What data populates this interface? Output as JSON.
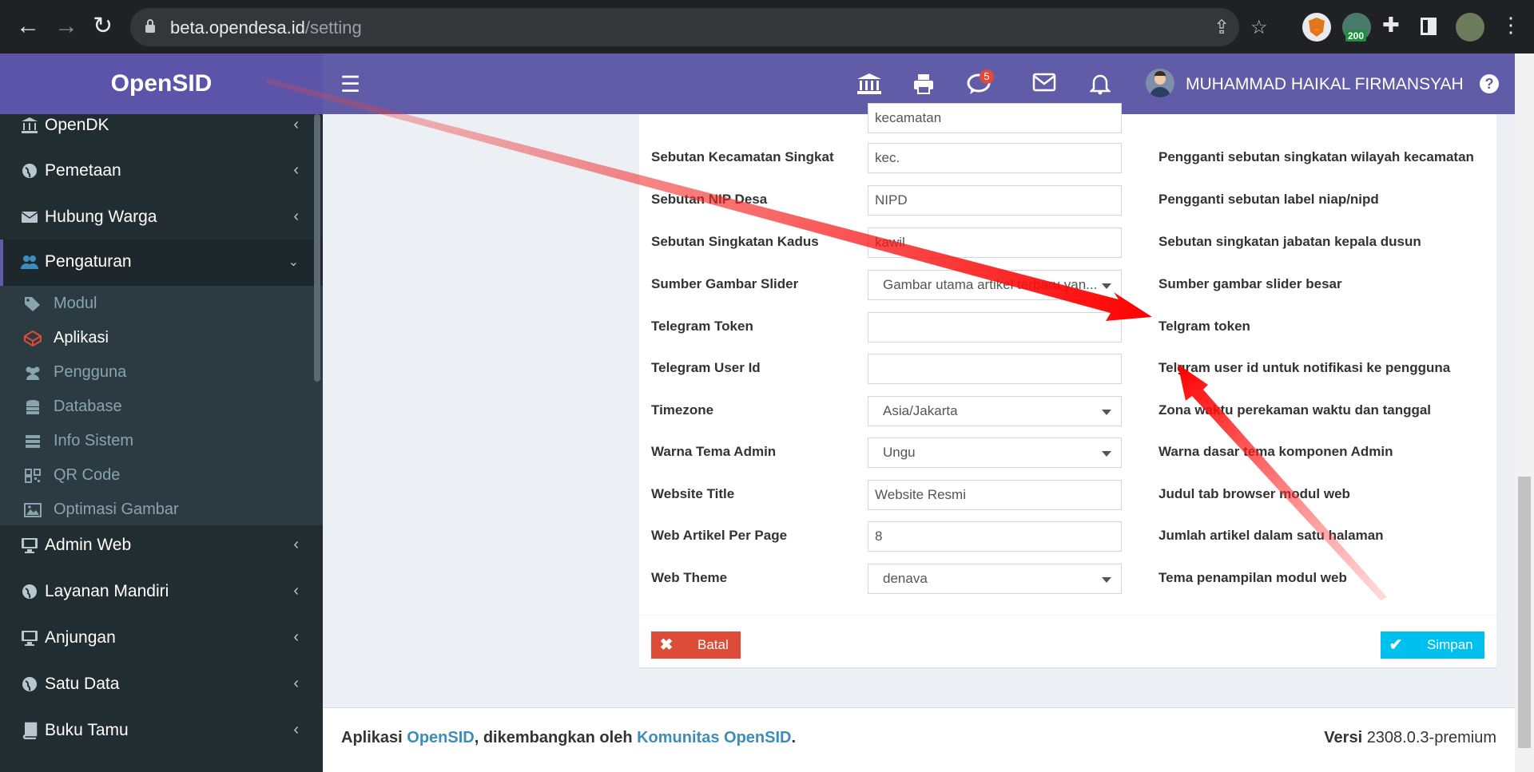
{
  "browser": {
    "url_host": "beta.opendesa.id",
    "url_path": "/setting",
    "ext_badge": "200"
  },
  "app": {
    "logo": "OpenSID",
    "username": "MUHAMMAD HAIKAL FIRMANSYAH",
    "notification_count": "5",
    "brand_color": "#605ca8"
  },
  "sidebar": {
    "items": [
      {
        "label": "OpenDK"
      },
      {
        "label": "Pemetaan"
      },
      {
        "label": "Hubung Warga"
      },
      {
        "label": "Pengaturan"
      },
      {
        "label": "Admin Web"
      },
      {
        "label": "Layanan Mandiri"
      },
      {
        "label": "Anjungan"
      },
      {
        "label": "Satu Data"
      },
      {
        "label": "Buku Tamu"
      }
    ],
    "subitems": [
      {
        "label": "Modul"
      },
      {
        "label": "Aplikasi"
      },
      {
        "label": "Pengguna"
      },
      {
        "label": "Database"
      },
      {
        "label": "Info Sistem"
      },
      {
        "label": "QR Code"
      },
      {
        "label": "Optimasi Gambar"
      }
    ]
  },
  "settings": {
    "rows": [
      {
        "label": "",
        "value": "kecamatan",
        "desc": "",
        "type": "input"
      },
      {
        "label": "Sebutan Kecamatan Singkat",
        "value": "kec.",
        "desc": "Pengganti sebutan singkatan wilayah kecamatan",
        "type": "input"
      },
      {
        "label": "Sebutan NIP Desa",
        "value": "NIPD",
        "desc": "Pengganti sebutan label niap/nipd",
        "type": "input"
      },
      {
        "label": "Sebutan Singkatan Kadus",
        "value": "kawil",
        "desc": "Sebutan singkatan jabatan kepala dusun",
        "type": "input"
      },
      {
        "label": "Sumber Gambar Slider",
        "value": "Gambar utama artikel terbaru yan...",
        "desc": "Sumber gambar slider besar",
        "type": "select"
      },
      {
        "label": "Telegram Token",
        "value": "",
        "desc": "Telgram token",
        "type": "input"
      },
      {
        "label": "Telegram User Id",
        "value": "",
        "desc": "Telgram user id untuk notifikasi ke pengguna",
        "type": "input"
      },
      {
        "label": "Timezone",
        "value": "Asia/Jakarta",
        "desc": "Zona waktu perekaman waktu dan tanggal",
        "type": "select"
      },
      {
        "label": "Warna Tema Admin",
        "value": "Ungu",
        "desc": "Warna dasar tema komponen Admin",
        "type": "select"
      },
      {
        "label": "Website Title",
        "value": "Website Resmi",
        "desc": "Judul tab browser modul web",
        "type": "input"
      },
      {
        "label": "Web Artikel Per Page",
        "value": "8",
        "desc": "Jumlah artikel dalam satu halaman",
        "type": "input"
      },
      {
        "label": "Web Theme",
        "value": "denava",
        "desc": "Tema penampilan modul web",
        "type": "select"
      }
    ],
    "cancel_label": "Batal",
    "save_label": "Simpan"
  },
  "footer": {
    "prefix": "Aplikasi ",
    "app_link": "OpenSID",
    "middle": ", dikembangkan oleh ",
    "community_link": "Komunitas OpenSID",
    "suffix": ".",
    "version_label": "Versi",
    "version_value": "2308.0.3-premium"
  }
}
